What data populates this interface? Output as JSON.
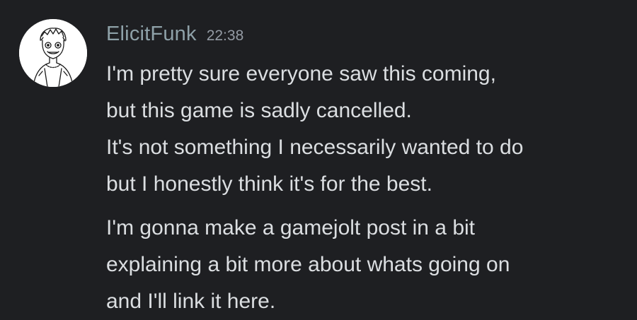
{
  "message": {
    "author": "ElicitFunk",
    "timestamp": "22:38",
    "avatar_icon": "sketch-character-avatar",
    "author_color": "#8ea1a8",
    "paragraphs": [
      {
        "lines": [
          "I'm pretty sure everyone saw this coming,",
          "but this game is sadly cancelled.",
          "It's not something I necessarily wanted to do",
          "but I honestly think it's for the best."
        ]
      },
      {
        "lines": [
          "I'm gonna make a gamejolt post in a bit",
          "explaining a bit more about whats going on",
          "and I'll link it here."
        ]
      }
    ]
  }
}
